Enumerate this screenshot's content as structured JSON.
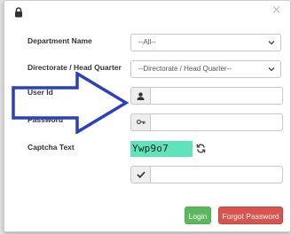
{
  "form": {
    "department_label": "Department Name",
    "department_value": "--All--",
    "directorate_label": "Directorate / Head Quarter",
    "directorate_value": "--Directorate / Head Quarter--",
    "userid_label": "User Id",
    "userid_value": "",
    "password_label": "Password",
    "password_value": "",
    "captcha_label": "Captcha Text",
    "captcha_text": "Ywp9o7",
    "captcha_input_value": ""
  },
  "buttons": {
    "login_label": "Login",
    "forgot_label": "Forgot Password"
  },
  "icons": {
    "header": "lock-icon",
    "close": "close-icon",
    "user": "user-icon",
    "key": "key-icon",
    "refresh": "refresh-icon",
    "check": "check-icon",
    "select_chevron": "chevron-down-icon",
    "annotation": "arrow-icon"
  },
  "colors": {
    "captcha_bg": "#5fe3b8",
    "login_button": "#5cb85c",
    "forgot_button": "#d9534f",
    "annotation_arrow": "#2b3fbf"
  }
}
